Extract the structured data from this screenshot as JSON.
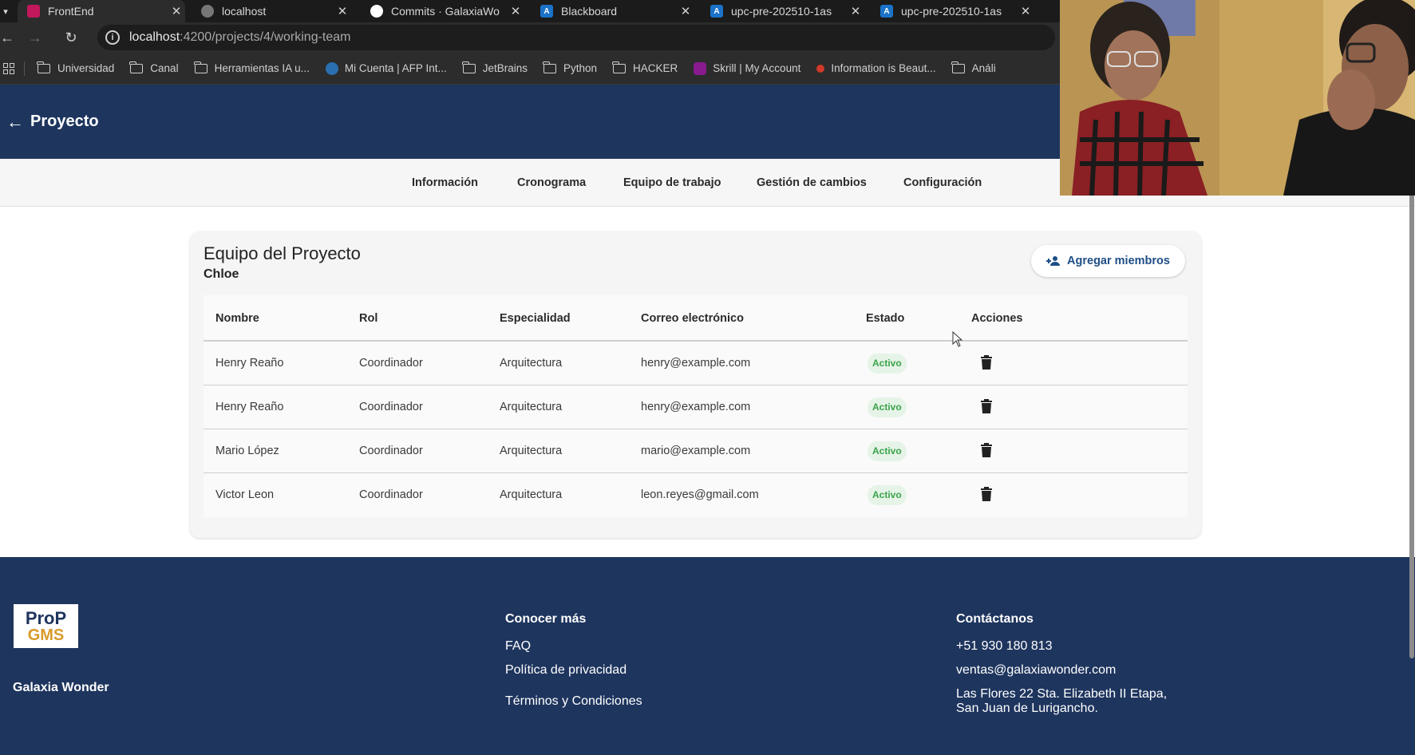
{
  "browser": {
    "tabs": [
      {
        "title": "FrontEnd",
        "icon": "angular-icon",
        "color": "#c2185b",
        "active": true
      },
      {
        "title": "localhost",
        "icon": "globe-icon",
        "color": "#888888",
        "active": false
      },
      {
        "title": "Commits · GalaxiaWo",
        "icon": "github-icon",
        "color": "#ffffff",
        "active": false
      },
      {
        "title": "Blackboard",
        "icon": "blackboard-icon",
        "color": "#1a73c8",
        "active": false
      },
      {
        "title": "upc-pre-202510-1as",
        "icon": "azure-icon",
        "color": "#1a73c8",
        "active": false
      },
      {
        "title": "upc-pre-202510-1as",
        "icon": "azure-icon",
        "color": "#1a73c8",
        "active": false
      }
    ],
    "url_host": "localhost",
    "url_path": ":4200/projects/4/working-team",
    "bookmarks": [
      {
        "label": "Universidad",
        "icon": "folder-icon"
      },
      {
        "label": "Canal",
        "icon": "folder-icon"
      },
      {
        "label": "Herramientas IA u...",
        "icon": "folder-icon"
      },
      {
        "label": "Mi Cuenta | AFP Int...",
        "icon": "afp-icon"
      },
      {
        "label": "JetBrains",
        "icon": "folder-icon"
      },
      {
        "label": "Python",
        "icon": "folder-icon"
      },
      {
        "label": "HACKER",
        "icon": "folder-icon"
      },
      {
        "label": "Skrill | My Account",
        "icon": "skrill-icon"
      },
      {
        "label": "Information is Beaut...",
        "icon": "info-beautiful-icon"
      },
      {
        "label": "Análi",
        "icon": "folder-icon"
      }
    ]
  },
  "header": {
    "title": "Proyecto"
  },
  "subnav": [
    "Información",
    "Cronograma",
    "Equipo de trabajo",
    "Gestión de cambios",
    "Configuración"
  ],
  "card": {
    "title": "Equipo del Proyecto",
    "subtitle": "Chloe",
    "add_button": "Agregar miembros",
    "columns": [
      "Nombre",
      "Rol",
      "Especialidad",
      "Correo electrónico",
      "Estado",
      "Acciones"
    ],
    "rows": [
      {
        "name": "Henry Reaño",
        "role": "Coordinador",
        "specialty": "Arquitectura",
        "email": "henry@example.com",
        "status": "Activo"
      },
      {
        "name": "Henry Reaño",
        "role": "Coordinador",
        "specialty": "Arquitectura",
        "email": "henry@example.com",
        "status": "Activo"
      },
      {
        "name": "Mario López",
        "role": "Coordinador",
        "specialty": "Arquitectura",
        "email": "mario@example.com",
        "status": "Activo"
      },
      {
        "name": "Victor Leon",
        "role": "Coordinador",
        "specialty": "Arquitectura",
        "email": "leon.reyes@gmail.com",
        "status": "Activo"
      }
    ]
  },
  "footer": {
    "logo_line1": "ProP",
    "logo_line2": "GMS",
    "company": "Galaxia Wonder",
    "more_title": "Conocer más",
    "more_links": [
      "FAQ",
      "Política de privacidad",
      "Términos y Condiciones"
    ],
    "contact_title": "Contáctanos",
    "phone": "+51 930 180 813",
    "email": "ventas@galaxiawonder.com",
    "address_line1": "Las Flores 22 Sta. Elizabeth II Etapa,",
    "address_line2": "San Juan de Lurigancho."
  },
  "colors": {
    "brand": "#1e355e",
    "accent": "#1e4e86",
    "active_badge": "#3aa34a"
  }
}
